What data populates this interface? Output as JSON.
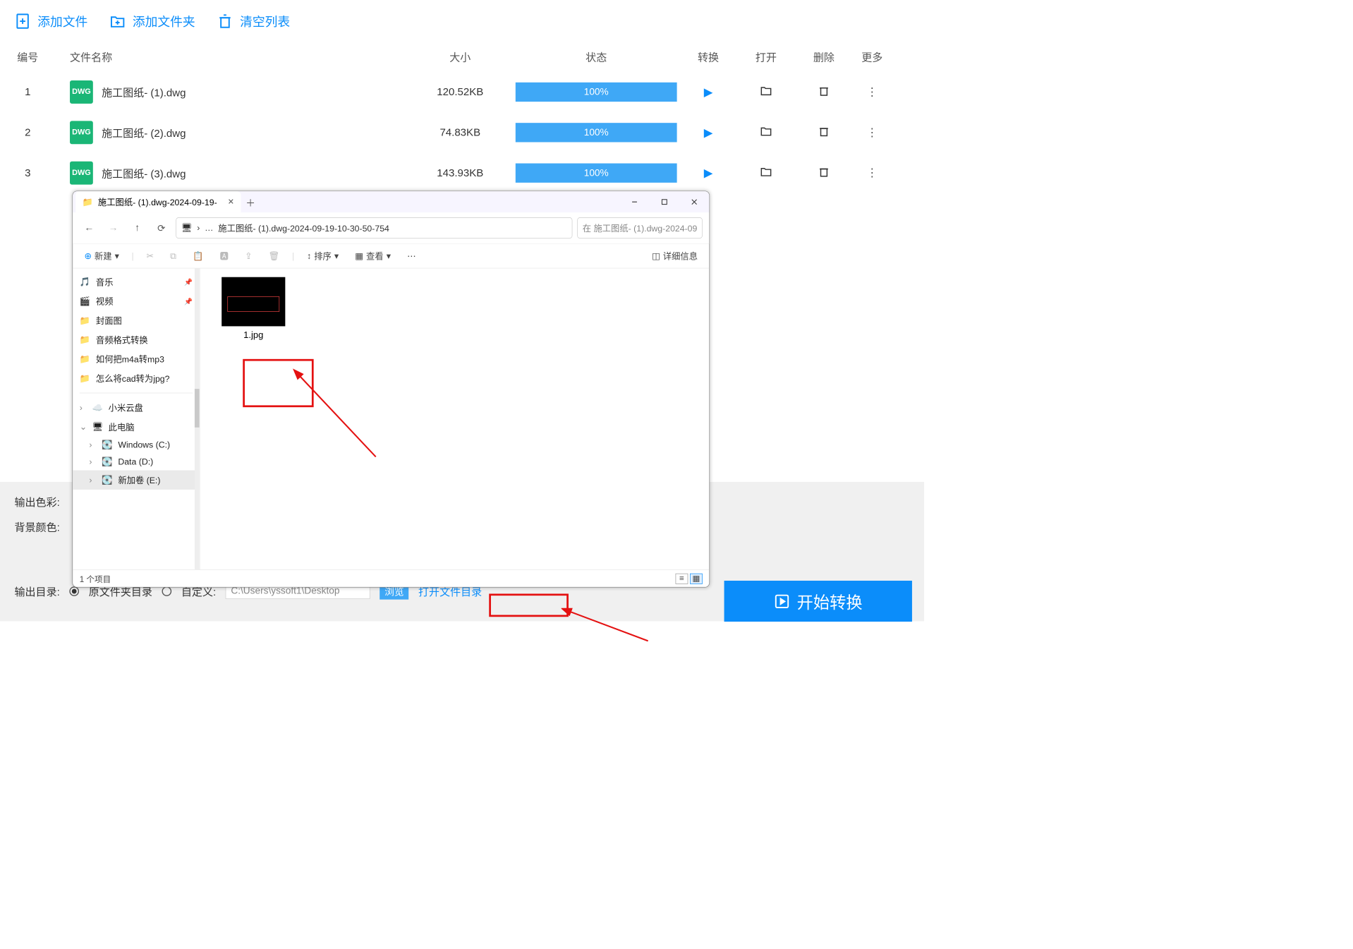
{
  "toolbar": {
    "add_file": "添加文件",
    "add_folder": "添加文件夹",
    "clear_list": "清空列表"
  },
  "table": {
    "headers": {
      "num": "编号",
      "name": "文件名称",
      "size": "大小",
      "status": "状态",
      "convert": "转换",
      "open": "打开",
      "delete": "删除",
      "more": "更多"
    },
    "rows": [
      {
        "num": "1",
        "badge": "DWG",
        "name": "施工图纸- (1).dwg",
        "size": "120.52KB",
        "progress": "100%"
      },
      {
        "num": "2",
        "badge": "DWG",
        "name": "施工图纸- (2).dwg",
        "size": "74.83KB",
        "progress": "100%"
      },
      {
        "num": "3",
        "badge": "DWG",
        "name": "施工图纸- (3).dwg",
        "size": "143.93KB",
        "progress": "100%"
      }
    ]
  },
  "bottom": {
    "color_label": "输出色彩:",
    "bg_label": "背景颜色:",
    "outdir_label": "输出目录:",
    "orig_dir": "原文件夹目录",
    "custom": "自定义:",
    "path_placeholder": "C:\\Users\\yssoft1\\Desktop",
    "browse": "浏览",
    "open_dir": "打开文件目录",
    "start": "开始转换"
  },
  "explorer": {
    "tab_title": "施工图纸- (1).dwg-2024-09-19-",
    "addr_crumb": "施工图纸- (1).dwg-2024-09-19-10-30-50-754",
    "search_placeholder": "在 施工图纸- (1).dwg-2024-09",
    "tools": {
      "new": "新建",
      "sort": "排序",
      "view": "查看",
      "details": "详细信息"
    },
    "sidebar": {
      "music": "音乐",
      "video": "视频",
      "cover": "封面图",
      "audio_fmt": "音频格式转换",
      "m4a": "如何把m4a转mp3",
      "cadjpg": "怎么将cad转为jpg?",
      "xiaomi": "小米云盘",
      "thispc": "此电脑",
      "c": "Windows (C:)",
      "d": "Data (D:)",
      "e": "新加卷 (E:)"
    },
    "thumb_name": "1.jpg",
    "status_text": "1 个项目"
  }
}
